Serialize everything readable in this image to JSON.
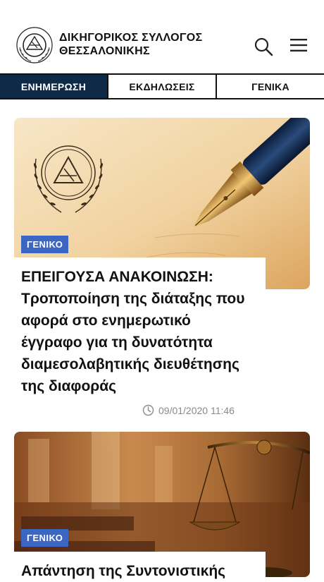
{
  "header": {
    "org_line1": "ΔΙΚΗΓΟΡΙΚΟΣ ΣΥΛΛΟΓΟΣ",
    "org_line2": "ΘΕΣΣΑΛΟΝΙΚΗΣ"
  },
  "tabs": [
    {
      "label": "ΕΝΗΜΕΡΩΣΗ",
      "active": true
    },
    {
      "label": "ΕΚΔΗΛΩΣΕΙΣ",
      "active": false
    },
    {
      "label": "ΓΕΝΙΚΑ",
      "active": false
    }
  ],
  "articles": [
    {
      "category": "ΓΕΝΙΚΟ",
      "title": "ΕΠΕΙΓΟΥΣΑ ΑΝΑΚΟΙΝΩΣΗ: Τροποποίηση της διάταξης που αφορά στο ενημερωτικό έγγραφο για τη δυνατότητα διαμεσολαβητικής διευθέτησης της διαφοράς",
      "date": "09/01/2020 11:46"
    },
    {
      "category": "ΓΕΝΙΚΟ",
      "title": "Απάντηση της Συντονιστικής"
    }
  ],
  "colors": {
    "active_tab_bg": "#0e2a47",
    "badge_bg": "#3b66c4"
  },
  "icons": {
    "logo": "bar-association-seal",
    "search": "search-icon",
    "menu": "hamburger-menu-icon",
    "clock": "clock-icon"
  }
}
